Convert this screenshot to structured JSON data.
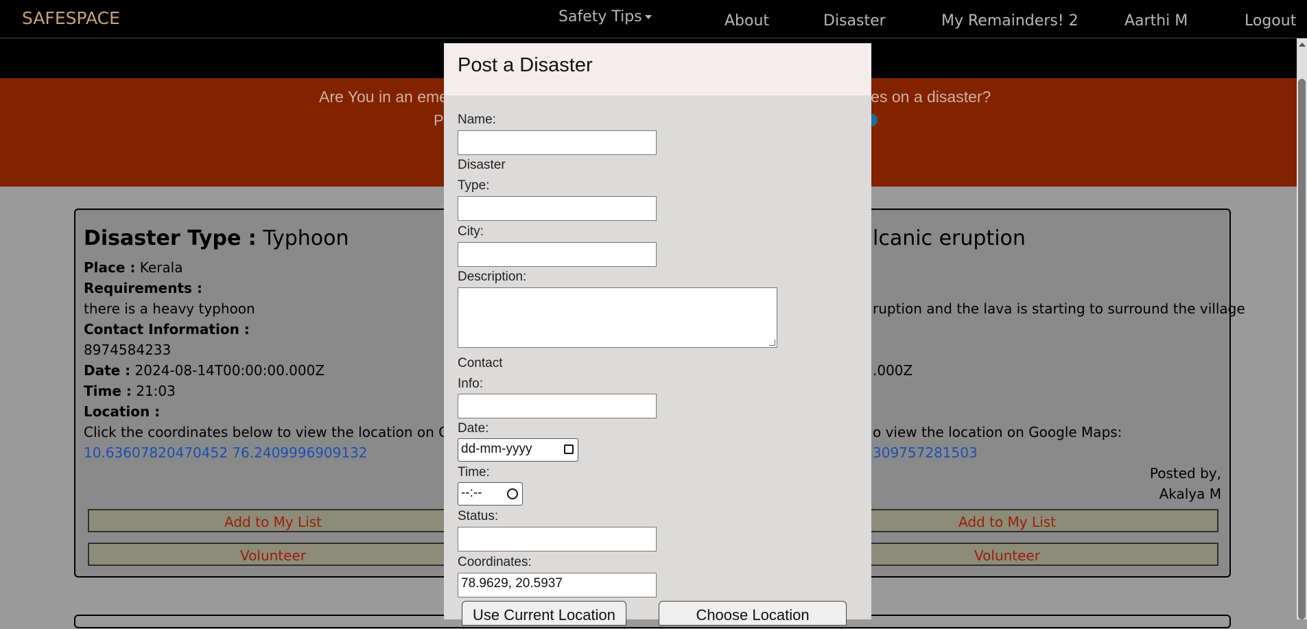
{
  "navbar": {
    "brand": "SAFESPACE",
    "safety_tips": "Safety Tips",
    "about": "About",
    "disaster": "Disaster",
    "reminders": "My Remainders! 2",
    "user": "Aarthi M",
    "logout": "Logout"
  },
  "banner": {
    "line1_left": "Are You in an eme",
    "line1_right": "ates on a disaster?",
    "line2_left": "Po"
  },
  "cards": [
    {
      "type_label": "Disaster Type :",
      "type_value": "Typhoon",
      "place_label": "Place :",
      "place_value": "Kerala",
      "requirements_label": "Requirements :",
      "requirements_value": "there is a heavy typhoon",
      "contact_label": "Contact Information :",
      "contact_value": "8974584233",
      "date_label": "Date :",
      "date_value": "2024-08-14T00:00:00.000Z",
      "time_label": "Time :",
      "time_value": "21:03",
      "location_label": "Location :",
      "location_hint": "Click the coordinates below to view the location on Googl",
      "coordinates": "10.63607820470452 76.2409996909132",
      "add_button": "Add to My List",
      "volunteer_button": "Volunteer"
    },
    {
      "type_value": "lcanic eruption",
      "requirements_value": "ruption and the lava is starting to surround the village",
      "date_value": ".000Z",
      "location_hint": "o view the location on Google Maps:",
      "coordinates": "309757281503",
      "posted_by_label": "Posted by,",
      "posted_by_value": "Akalya M",
      "add_button": "Add to My List",
      "volunteer_button": "Volunteer"
    }
  ],
  "modal": {
    "title": "Post a Disaster",
    "name_label": "Name:",
    "type_label_1": "Disaster",
    "type_label_2": "Type:",
    "city_label": "City:",
    "description_label": "Description:",
    "contact_label_1": "Contact",
    "contact_label_2": "Info:",
    "date_label": "Date:",
    "date_placeholder": "dd-mm-yyyy",
    "time_label": "Time:",
    "time_placeholder": "--:--",
    "status_label": "Status:",
    "coordinates_label": "Coordinates:",
    "coordinates_value": "78.9629, 20.5937",
    "use_current_location": "Use Current Location",
    "choose_location": "Choose Location"
  },
  "colors": {
    "banner": "#822200",
    "modal_header": "#f5ecec",
    "modal_body": "#dddada",
    "link": "#1a4fb5"
  }
}
